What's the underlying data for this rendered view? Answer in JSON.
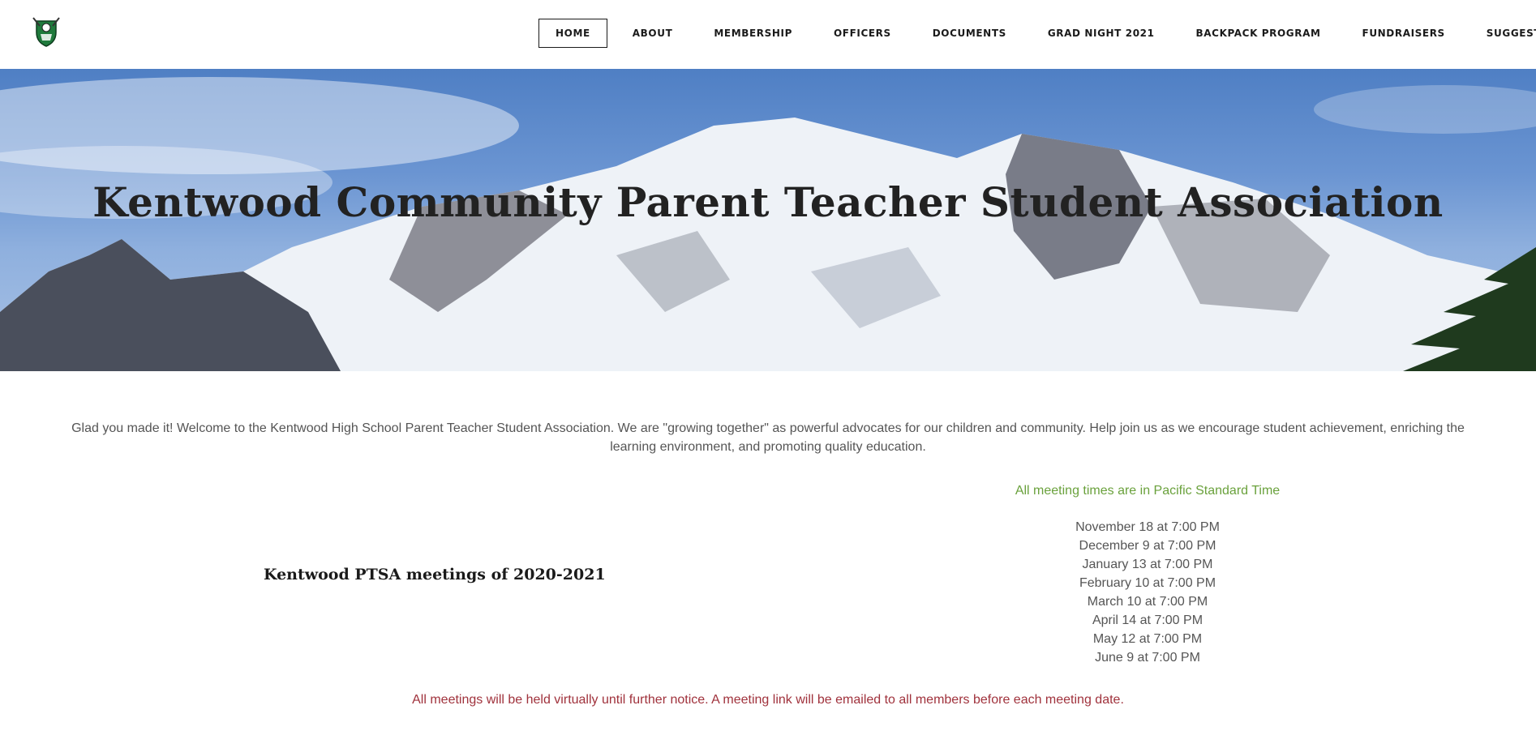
{
  "header": {
    "logo_icon": "kentwood-crest-icon",
    "nav": [
      {
        "label": "HOME",
        "active": true
      },
      {
        "label": "ABOUT"
      },
      {
        "label": "MEMBERSHIP"
      },
      {
        "label": "OFFICERS"
      },
      {
        "label": "DOCUMENTS"
      },
      {
        "label": "GRAD NIGHT 2021"
      },
      {
        "label": "BACKPACK PROGRAM"
      },
      {
        "label": "FUNDRAISERS"
      },
      {
        "label": "SUGGESTIONS"
      }
    ]
  },
  "hero": {
    "title": "Kentwood Community Parent Teacher Student Association"
  },
  "main": {
    "intro": "Glad you made it! Welcome to the Kentwood High School Parent Teacher Student Association. We are \"growing together\" as powerful advocates for our children and community. Help join us as we encourage student achievement, enriching the learning environment, and promoting quality education.",
    "meetings_heading": "Kentwood PTSA meetings of 2020-2021",
    "timezone_note": "All meeting times are in Pacific Standard Time",
    "meeting_dates": [
      "November 18 at 7:00 PM",
      "December 9 at 7:00 PM",
      "January 13 at 7:00 PM",
      "February 10 at 7:00 PM",
      "March 10 at 7:00 PM",
      "April 14 at 7:00 PM",
      "May 12 at 7:00 PM",
      "June 9 at 7:00 PM"
    ],
    "virtual_note": "All meetings will be held virtually until further notice. A meeting link will be emailed to all members before each meeting date."
  },
  "colors": {
    "timezone_note": "#6aa13c",
    "virtual_note": "#a0323c",
    "body_text": "#555555",
    "nav_text": "#1a1a1a"
  }
}
